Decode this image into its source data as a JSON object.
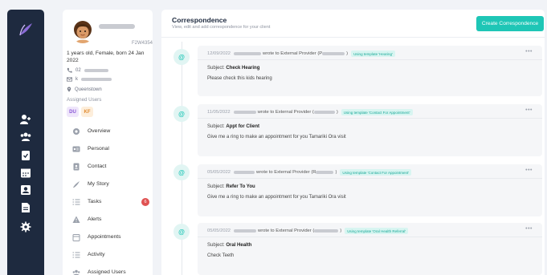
{
  "rail": {
    "icons": [
      "logo-icon",
      "add-user-icon",
      "group-icon",
      "clipboard-check-icon",
      "calendar-icon",
      "user-badge-icon",
      "document-icon",
      "settings-icon"
    ]
  },
  "profile": {
    "id": "F2W4354",
    "age_line": "1 years old, Female, born 24 Jan 2022",
    "phone": "02",
    "email": "k",
    "location": "Queenstown",
    "assigned_label": "Assigned Users",
    "assigned": [
      {
        "initials": "DU",
        "color": "#8a57d6",
        "bg": "#efe6fb"
      },
      {
        "initials": "KF",
        "color": "#e08a2e",
        "bg": "#fdeedb"
      }
    ],
    "nav": [
      {
        "label": "Overview",
        "icon": "overview-icon"
      },
      {
        "label": "Personal",
        "icon": "id-card-icon"
      },
      {
        "label": "Contact",
        "icon": "contact-book-icon"
      },
      {
        "label": "My Story",
        "icon": "story-icon"
      },
      {
        "label": "Tasks",
        "icon": "list-icon",
        "badge": "6"
      },
      {
        "label": "Alerts",
        "icon": "warning-icon"
      },
      {
        "label": "Appointments",
        "icon": "calendar-icon"
      },
      {
        "label": "Activity",
        "icon": "activity-icon"
      },
      {
        "label": "Assigned Users",
        "icon": "users-icon"
      }
    ]
  },
  "main": {
    "title": "Correspondence",
    "subtitle": "View, edit and add correspondence for your client",
    "create_label": "Create Correspondence",
    "entries": [
      {
        "date": "12/09/2022",
        "wrote": "wrote to External Provider (P",
        "tpl": "Using template 'Hearing'",
        "subject_label": "Subject:",
        "subject": "Check Hearing",
        "body": "Please check this kids hearing"
      },
      {
        "date": "11/05/2022",
        "wrote": "wrote to External Provider (",
        "tpl": "Using template 'Contact For Appointment'",
        "subject_label": "Subject:",
        "subject": "Appt for Client",
        "body": "Give me a ring to make an appointment for you Tamariki Ora visit"
      },
      {
        "date": "05/05/2022",
        "wrote": "wrote to External Provider (R",
        "tpl": "Using template 'Contact For Appointment'",
        "subject_label": "Subject:",
        "subject": "Refer To You",
        "body": "Give me a ring to make an appointment for you Tamariki Ora visit"
      },
      {
        "date": "05/05/2022",
        "wrote": "wrote to External Provider (",
        "tpl": "Using template 'Oral Health Referral'",
        "subject_label": "Subject:",
        "subject": "Oral Health",
        "body": "Check Teeth"
      }
    ],
    "more": "•••",
    "at": "@"
  },
  "colors": {
    "accent": "#1ec6b6",
    "rail": "#1e2a3f",
    "badge": "#e05252"
  }
}
